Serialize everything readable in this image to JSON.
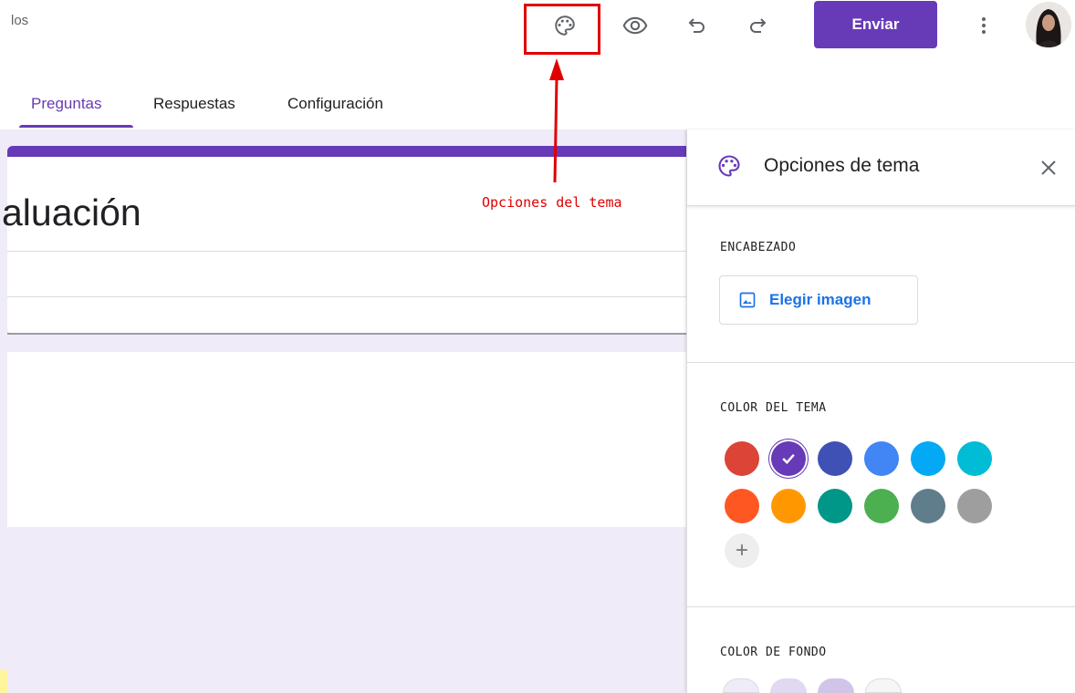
{
  "header": {
    "doc_title": "los",
    "send_label": "Enviar"
  },
  "tabs": [
    {
      "label": "Preguntas",
      "active": true
    },
    {
      "label": "Respuestas",
      "active": false
    },
    {
      "label": "Configuración",
      "active": false
    }
  ],
  "form": {
    "title": "aluación"
  },
  "annotation": {
    "label": "Opciones del tema",
    "color": "#e00000"
  },
  "theme_panel": {
    "title": "Opciones de tema",
    "header_section_label": "ENCABEZADO",
    "choose_image_label": "Elegir imagen",
    "theme_color_label": "COLOR DEL TEMA",
    "theme_colors": [
      "#db4437",
      "#673ab7",
      "#3f51b5",
      "#4285f4",
      "#03a9f4",
      "#00bcd4",
      "#ff5722",
      "#ff9800",
      "#009688",
      "#4caf50",
      "#607d8b",
      "#9e9e9e"
    ],
    "selected_color": "#673ab7",
    "add_color_label": "+",
    "background_color_label": "COLOR DE FONDO",
    "background_colors": [
      "#f0ebf8",
      "#e1d8f1",
      "#d1c4e9",
      "#f6f6f6"
    ]
  },
  "colors": {
    "accent": "#673ab7",
    "canvas_bg": "#f0ebf8",
    "link_blue": "#1a73e8"
  }
}
